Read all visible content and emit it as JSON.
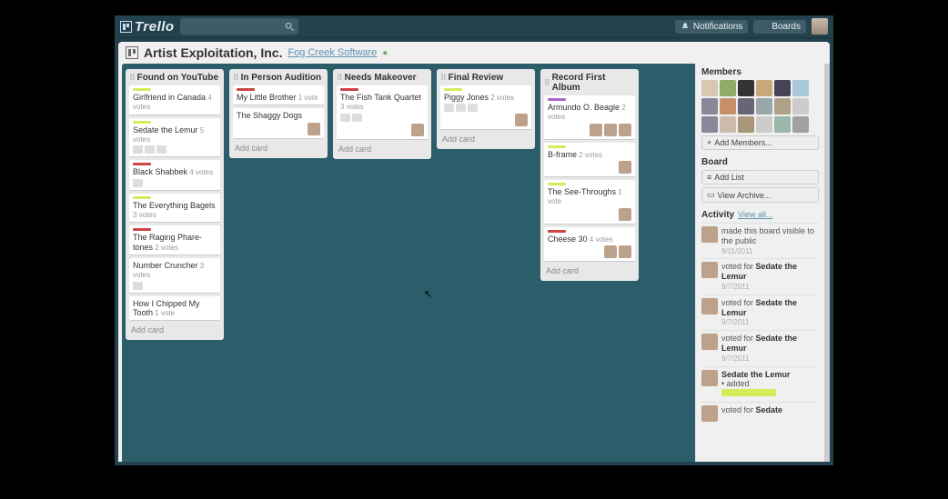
{
  "app": {
    "name": "Trello"
  },
  "topbar": {
    "notifications": "Notifications",
    "boards": "Boards"
  },
  "board": {
    "title": "Artist Exploitation, Inc.",
    "org": "Fog Creek Software"
  },
  "lists": [
    {
      "title": "Found on YouTube",
      "cards": [
        {
          "title": "Girlfriend in Canada",
          "votes": "4 votes",
          "labels": [
            "#d7ea5b"
          ]
        },
        {
          "title": "Sedate the Lemur",
          "votes": "5 votes",
          "labels": [
            "#d7ea5b"
          ],
          "badges": 3
        },
        {
          "title": "Black Shabbek",
          "votes": "4 votes",
          "labels": [
            "#c44"
          ],
          "badges": 1
        },
        {
          "title": "The Everything Bagels",
          "votes": "3 votes",
          "labels": [
            "#d7ea5b"
          ]
        },
        {
          "title": "The Raging Phare-tones",
          "votes": "2 votes",
          "labels": [
            "#c44"
          ]
        },
        {
          "title": "Number Cruncher",
          "votes": "3 votes",
          "labels": [],
          "badges": 1
        },
        {
          "title": "How I Chipped My Tooth",
          "votes": "1 vote",
          "labels": []
        }
      ],
      "addLabel": "Add card"
    },
    {
      "title": "In Person Audition",
      "cards": [
        {
          "title": "My Little Brother",
          "votes": "1 vote",
          "labels": [
            "#c44"
          ]
        },
        {
          "title": "The Shaggy Dogs",
          "votes": "",
          "labels": [],
          "members": 1
        }
      ],
      "addLabel": "Add card"
    },
    {
      "title": "Needs Makeover",
      "cards": [
        {
          "title": "The Fish Tank Quartet",
          "votes": "3 votes",
          "labels": [
            "#c44"
          ],
          "badges": 2,
          "members": 1
        }
      ],
      "addLabel": "Add card"
    },
    {
      "title": "Final Review",
      "cards": [
        {
          "title": "Piggy Jones",
          "votes": "2 votes",
          "labels": [
            "#d7ea5b"
          ],
          "badges": 3,
          "members": 1
        }
      ],
      "addLabel": "Add card"
    },
    {
      "title": "Record First Album",
      "cards": [
        {
          "title": "Armundo O. Beagle",
          "votes": "2 votes",
          "labels": [
            "#a6c"
          ],
          "members": 3
        },
        {
          "title": "B-frame",
          "votes": "2 votes",
          "labels": [
            "#d7ea5b"
          ],
          "members": 1
        },
        {
          "title": "The See-Throughs",
          "votes": "1 vote",
          "labels": [
            "#d7ea5b"
          ],
          "members": 1
        },
        {
          "title": "Cheese 30",
          "votes": "4 votes",
          "labels": [
            "#c44"
          ],
          "members": 2
        }
      ],
      "addLabel": "Add card"
    }
  ],
  "sidebar": {
    "membersHeading": "Members",
    "memberCount": 18,
    "addMembers": "Add Members...",
    "boardHeading": "Board",
    "addList": "Add List",
    "viewArchive": "View Archive...",
    "activityHeading": "Activity",
    "viewAll": "View all...",
    "activity": [
      {
        "text": "made this board visible to the public",
        "date": "9/11/2011"
      },
      {
        "text": "voted for",
        "bold": "Sedate the Lemur",
        "date": "9/7/2011"
      },
      {
        "text": "voted for",
        "bold": "Sedate the Lemur",
        "date": "9/7/2011"
      },
      {
        "text": "voted for",
        "bold": "Sedate the Lemur",
        "date": "9/7/2011"
      },
      {
        "boldFirst": "Sedate the Lemur",
        "text2": "added",
        "highlight": true
      },
      {
        "text": "voted for",
        "bold": "Sedate"
      }
    ]
  },
  "colors": {
    "memberAvatars": [
      "#d8c8b0",
      "#90a868",
      "#333",
      "#c8a878",
      "#445",
      "#a8c8d8",
      "#889",
      "#c89068",
      "#667",
      "#98a8a8",
      "#b0a088",
      "#ccc",
      "#889",
      "#cba",
      "#a89878",
      "#ccc",
      "#98b8a8",
      "#a0a0a0"
    ]
  }
}
